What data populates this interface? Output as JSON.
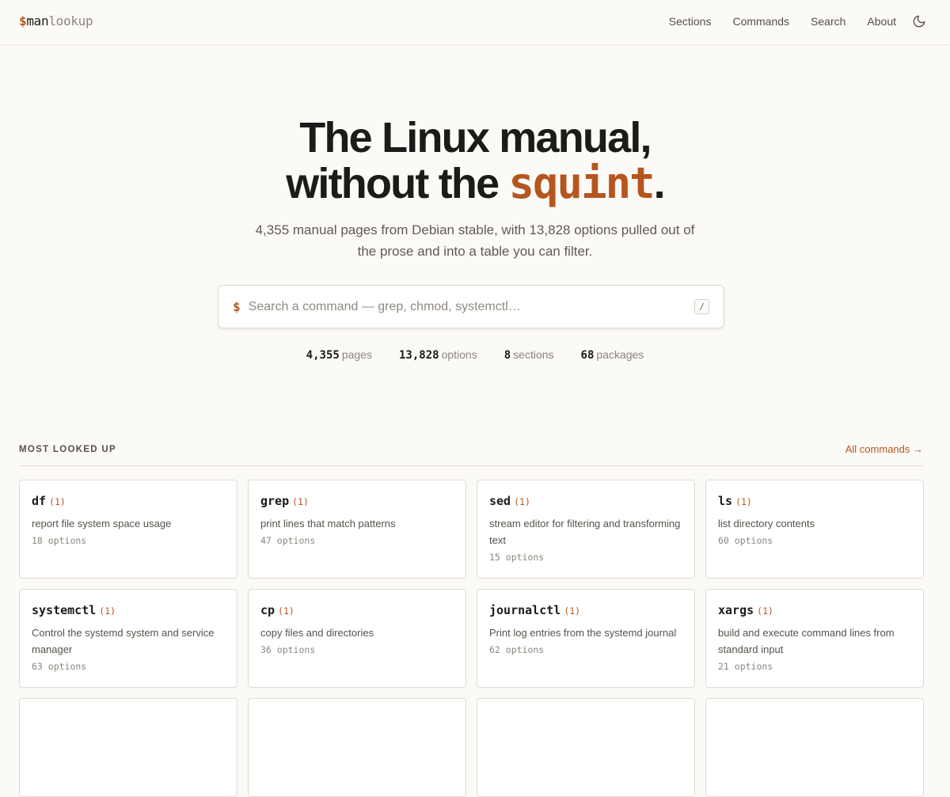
{
  "header": {
    "logo": {
      "dollar": "$",
      "man": "man",
      "lookup": "lookup"
    },
    "nav": [
      "Sections",
      "Commands",
      "Search",
      "About"
    ],
    "theme_icon": "moon-icon"
  },
  "hero": {
    "title_line1": "The Linux manual,",
    "title_line2_pre": "without the ",
    "title_accent": "squint",
    "title_end": ".",
    "subtitle": "4,355 manual pages from Debian stable, with 13,828 options pulled out of the prose and into a table you can filter."
  },
  "search": {
    "prompt": "$",
    "placeholder": "Search a command — grep, chmod, systemctl…",
    "value": "",
    "shortcut": "/"
  },
  "stats": [
    {
      "value": "4,355",
      "label": "pages"
    },
    {
      "value": "13,828",
      "label": "options"
    },
    {
      "value": "8",
      "label": "sections"
    },
    {
      "value": "68",
      "label": "packages"
    }
  ],
  "most_looked_up": {
    "title": "MOST LOOKED UP",
    "all_link": "All commands →",
    "cards": [
      {
        "cmd": "df",
        "section": "(1)",
        "desc": "report file system space usage",
        "options": "18 options"
      },
      {
        "cmd": "grep",
        "section": "(1)",
        "desc": "print lines that match patterns",
        "options": "47 options"
      },
      {
        "cmd": "sed",
        "section": "(1)",
        "desc": "stream editor for filtering and transforming text",
        "options": "15 options"
      },
      {
        "cmd": "ls",
        "section": "(1)",
        "desc": "list directory contents",
        "options": "60 options"
      },
      {
        "cmd": "systemctl",
        "section": "(1)",
        "desc": "Control the systemd system and service manager",
        "options": "63 options"
      },
      {
        "cmd": "cp",
        "section": "(1)",
        "desc": "copy files and directories",
        "options": "36 options"
      },
      {
        "cmd": "journalctl",
        "section": "(1)",
        "desc": "Print log entries from the systemd journal",
        "options": "62 options"
      },
      {
        "cmd": "xargs",
        "section": "(1)",
        "desc": "build and execute command lines from standard input",
        "options": "21 options"
      },
      {
        "cmd": "",
        "section": "",
        "desc": "",
        "options": ""
      },
      {
        "cmd": "",
        "section": "",
        "desc": "",
        "options": ""
      },
      {
        "cmd": "",
        "section": "",
        "desc": "",
        "options": ""
      },
      {
        "cmd": "",
        "section": "",
        "desc": "",
        "options": ""
      }
    ]
  },
  "colors": {
    "accent": "#b5561f",
    "background": "#fbfaf7",
    "text": "#1d1b19"
  }
}
